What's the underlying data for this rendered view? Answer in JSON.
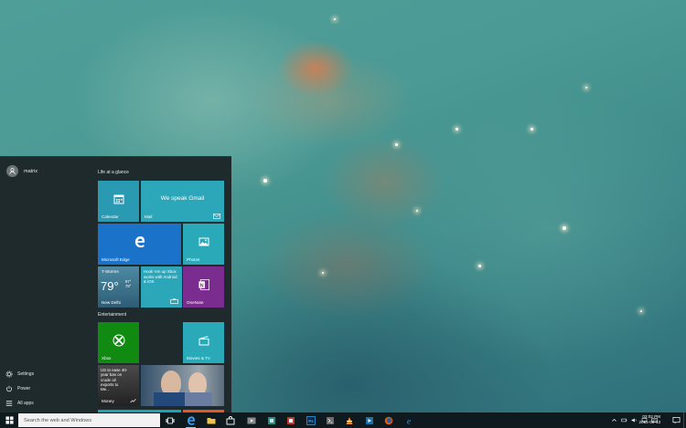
{
  "start_menu": {
    "user_name": "matrix",
    "left_items": [
      {
        "label": "Settings",
        "icon": "gear-icon"
      },
      {
        "label": "Power",
        "icon": "power-icon"
      },
      {
        "label": "All apps",
        "icon": "list-icon"
      }
    ],
    "groups": {
      "life_at_a_glance": "Life at a glance",
      "entertainment": "Entertainment"
    },
    "tiles": {
      "calendar": {
        "label": "Calendar",
        "icon": "calendar-icon"
      },
      "mail": {
        "label": "Mail",
        "headline": "We speak Gmail",
        "icon": "envelope-icon"
      },
      "edge": {
        "label": "Microsoft Edge",
        "icon": "edge-e-icon"
      },
      "photos": {
        "label": "Photos",
        "icon": "picture-icon"
      },
      "weather": {
        "condition": "T-Storms",
        "temperature": "79°",
        "high": "87°",
        "low": "78°",
        "city": "New Delhi"
      },
      "hook": {
        "text": "Hook 'em up Xbox works with Android & iOS",
        "icon": "store-bag-icon"
      },
      "onenote": {
        "label": "OneNote",
        "icon": "onenote-icon"
      },
      "xbox": {
        "label": "Xbox",
        "icon": "xbox-icon"
      },
      "movies": {
        "label": "Movies & TV",
        "icon": "clapperboard-icon"
      },
      "money": {
        "label": "Money",
        "headline": "US to ease 40-year ban on crude oil exports to Me..."
      }
    }
  },
  "taskbar": {
    "search_placeholder": "Search the web and Windows",
    "clock_time": "03:02 PM",
    "clock_date": "2015-08-13",
    "colors": {
      "accent": "#1b73c9",
      "taskbar": "#0e1a1d",
      "start_bg": "#1e2a2c"
    },
    "pinned_icons": [
      "task-view-icon",
      "edge-icon",
      "file-explorer-icon",
      "store-icon",
      "media-player-icon",
      "app-icon",
      "windows-app-icon",
      "photoshop-icon",
      "dev-tool-icon",
      "vlc-icon",
      "video-editor-icon",
      "ie-icon",
      "firefox-icon",
      "internet-explorer-icon"
    ],
    "tray_icons": [
      "chevron-up-icon",
      "battery-icon",
      "volume-icon",
      "network-icon",
      "keyboard-icon"
    ]
  }
}
